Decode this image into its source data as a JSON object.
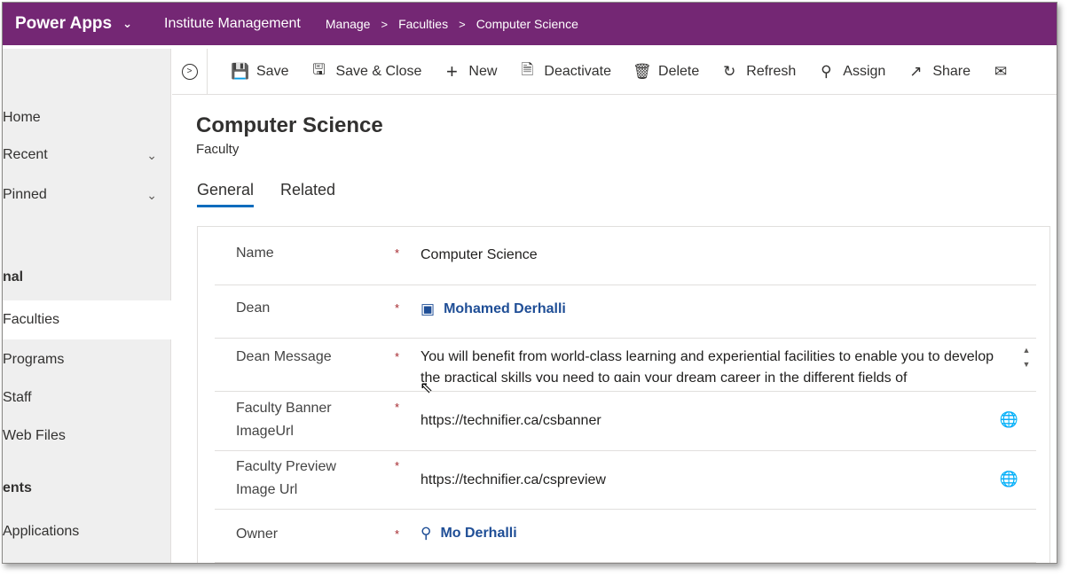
{
  "header": {
    "brand": "Power Apps",
    "app_name": "Institute Management",
    "breadcrumb": [
      "Manage",
      "Faculties",
      "Computer Science"
    ]
  },
  "sidebar": {
    "items": [
      {
        "label": "Home"
      },
      {
        "label": "Recent"
      },
      {
        "label": "Pinned"
      }
    ],
    "section1": "nal",
    "section1_items": [
      {
        "label": "Faculties"
      },
      {
        "label": "Programs"
      },
      {
        "label": "Staff"
      },
      {
        "label": "Web Files"
      }
    ],
    "section2": "ents",
    "section2_items": [
      {
        "label": "Applications"
      }
    ]
  },
  "commandbar": {
    "save": "Save",
    "save_close": "Save & Close",
    "new": "New",
    "deactivate": "Deactivate",
    "delete": "Delete",
    "refresh": "Refresh",
    "assign": "Assign",
    "share": "Share"
  },
  "record": {
    "title": "Computer Science",
    "entity": "Faculty"
  },
  "tabs": [
    {
      "label": "General"
    },
    {
      "label": "Related"
    }
  ],
  "form": {
    "name_label": "Name",
    "name_value": "Computer Science",
    "dean_label": "Dean",
    "dean_value": "Mohamed Derhalli",
    "message_label": "Dean Message",
    "message_value": "You will benefit from world-class learning and experiential facilities to enable you to develop the practical skills you need to gain your dream career in the different fields of",
    "banner_label_1": "Faculty Banner",
    "banner_label_2": "ImageUrl",
    "banner_value": "https://technifier.ca/csbanner",
    "preview_label_1": "Faculty Preview",
    "preview_label_2": "Image Url",
    "preview_value": "https://technifier.ca/cspreview",
    "owner_label": "Owner",
    "owner_value": "Mo Derhalli",
    "required_mark": "*"
  },
  "colors": {
    "header_bg": "#742774",
    "link": "#1f4e96",
    "required": "#a4262c",
    "tab_underline": "#0f6cbd"
  }
}
